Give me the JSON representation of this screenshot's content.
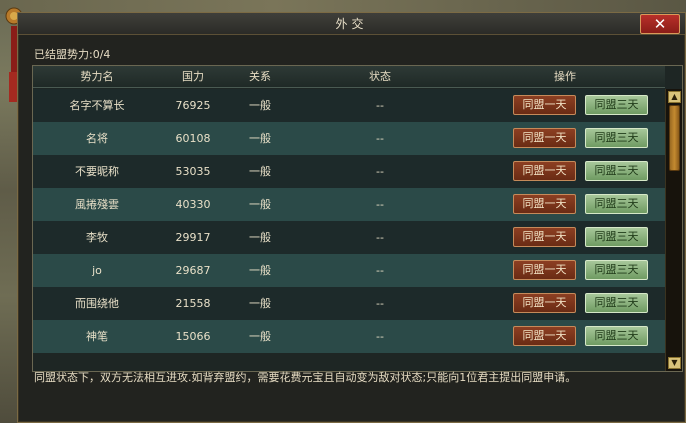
{
  "window": {
    "title": "外交",
    "close_label": "✕"
  },
  "alliance_count": "已结盟势力:0/4",
  "table": {
    "headers": {
      "name": "势力名",
      "power": "国力",
      "relation": "关系",
      "status": "状态",
      "ops": "操作"
    },
    "rows": [
      {
        "name": "名字不算长",
        "power": "76925",
        "relation": "一般",
        "status": "--",
        "btn_day": "同盟一天",
        "btn_three": "同盟三天"
      },
      {
        "name": "名将",
        "power": "60108",
        "relation": "一般",
        "status": "--",
        "btn_day": "同盟一天",
        "btn_three": "同盟三天"
      },
      {
        "name": "不要昵称",
        "power": "53035",
        "relation": "一般",
        "status": "--",
        "btn_day": "同盟一天",
        "btn_three": "同盟三天"
      },
      {
        "name": "風捲殘雲",
        "power": "40330",
        "relation": "一般",
        "status": "--",
        "btn_day": "同盟一天",
        "btn_three": "同盟三天"
      },
      {
        "name": "李牧",
        "power": "29917",
        "relation": "一般",
        "status": "--",
        "btn_day": "同盟一天",
        "btn_three": "同盟三天"
      },
      {
        "name": "jo",
        "power": "29687",
        "relation": "一般",
        "status": "--",
        "btn_day": "同盟一天",
        "btn_three": "同盟三天"
      },
      {
        "name": "而围绕他",
        "power": "21558",
        "relation": "一般",
        "status": "--",
        "btn_day": "同盟一天",
        "btn_three": "同盟三天"
      },
      {
        "name": "神笔",
        "power": "15066",
        "relation": "一般",
        "status": "--",
        "btn_day": "同盟一天",
        "btn_three": "同盟三天"
      }
    ]
  },
  "scroll": {
    "up_icon": "▲",
    "down_icon": "▼"
  },
  "footer_note": "同盟状态下，双方无法相互进攻.如背弃盟约，需要花费元宝且自动变为敌对状态;只能向1位君主提出同盟申请。",
  "colors": {
    "row_odd": "#1d2a2a",
    "row_even": "#2b4a48",
    "close_red": "#b8302a",
    "btn_day": "#8c3f22",
    "btn_three": "#a7c79a"
  }
}
